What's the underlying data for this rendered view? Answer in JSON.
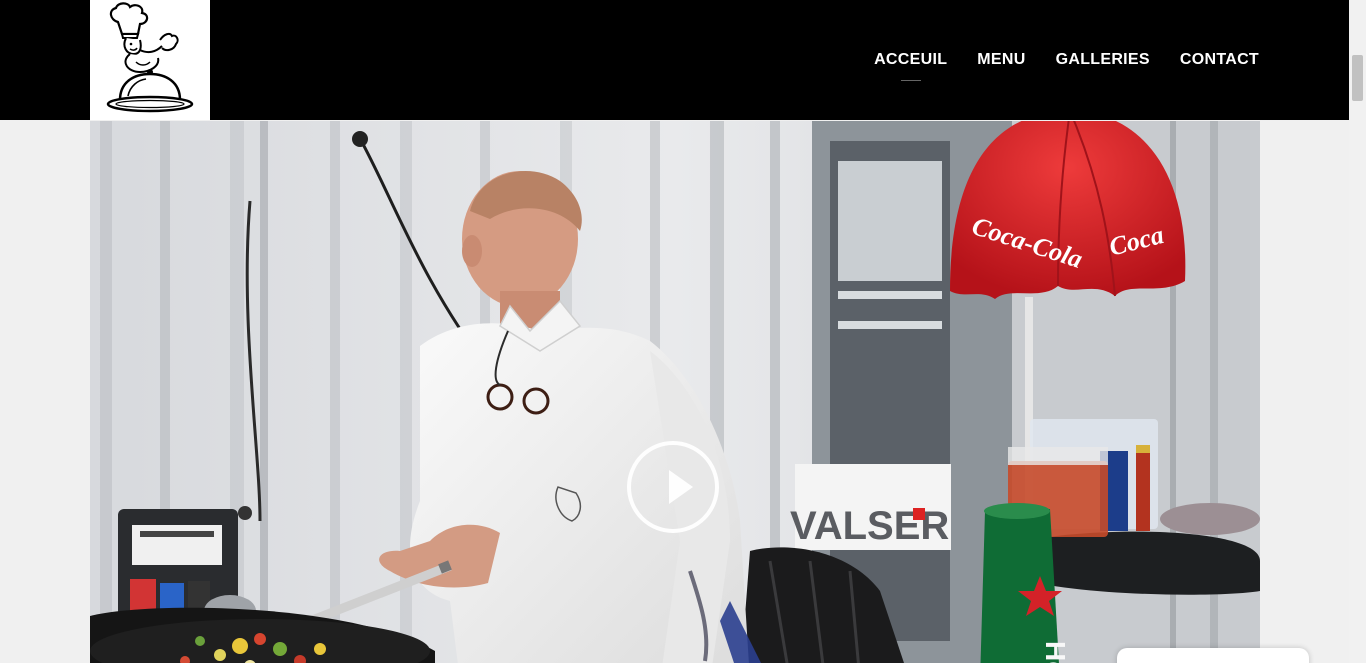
{
  "header": {
    "nav": [
      {
        "label": "ACCEUIL",
        "active": true
      },
      {
        "label": "MENU",
        "active": false
      },
      {
        "label": "GALLERIES",
        "active": false
      },
      {
        "label": "CONTACT",
        "active": false
      }
    ]
  },
  "video": {
    "sign_text": "VALSER",
    "umbrella_text": "Coca-Cola",
    "bin_text": "Heineken"
  },
  "colors": {
    "header_bg": "#000000",
    "nav_text": "#ffffff",
    "umbrella_red": "#d91f26"
  }
}
